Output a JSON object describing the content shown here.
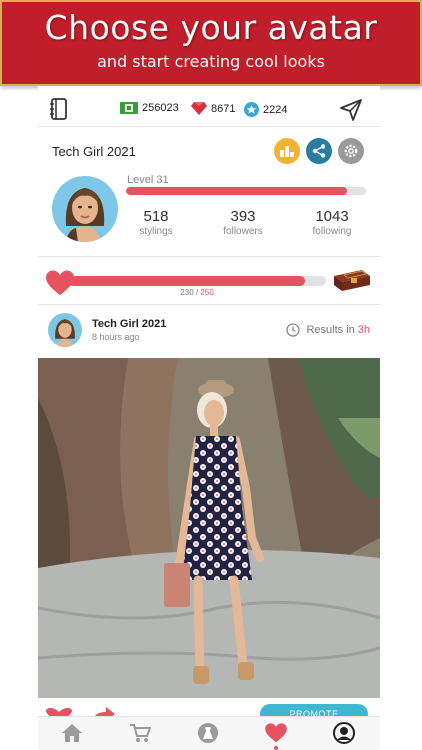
{
  "banner": {
    "title": "Choose your avatar",
    "subtitle": "and start creating cool looks"
  },
  "stats": {
    "cash": "256023",
    "gems": "8671",
    "coins": "2224"
  },
  "profile": {
    "username": "Tech Girl 2021",
    "level_label": "Level 31",
    "level_progress": 0.92,
    "stylings_count": "518",
    "stylings_label": "stylings",
    "followers_count": "393",
    "followers_label": "followers",
    "following_count": "1043",
    "following_label": "following"
  },
  "hearts": {
    "current": "230",
    "separator": " / ",
    "max": "250",
    "progress": 0.92
  },
  "post": {
    "username": "Tech Girl 2021",
    "time": "8 hours ago",
    "results_label": "Results in",
    "results_time": "3h",
    "promote_label": "PROMOTE"
  },
  "colors": {
    "banner_red": "#bf1e2a",
    "accent_pink": "#e6525f",
    "gold": "#f3b233",
    "share_blue": "#2a7da1",
    "promote_cyan": "#3fb8cf"
  },
  "icons": {
    "stats": [
      "journal-icon",
      "cash-icon",
      "gem-icon",
      "coin-icon",
      "send-icon"
    ],
    "tabs": [
      "home-icon",
      "cart-icon",
      "dress-icon",
      "heart-icon",
      "avatar-icon"
    ]
  }
}
